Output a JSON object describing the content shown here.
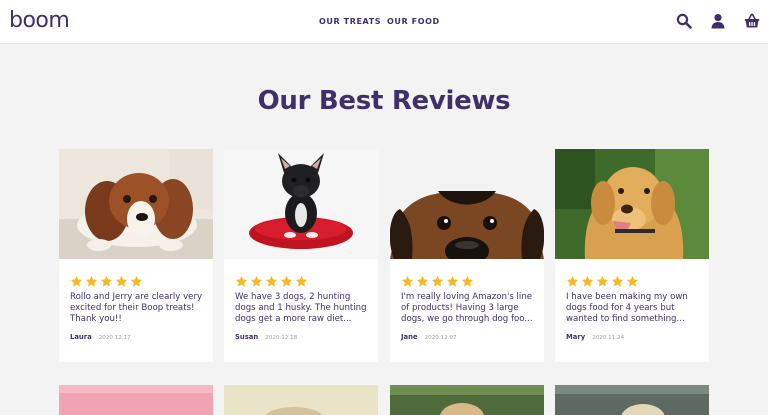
{
  "header": {
    "logo": "boom",
    "nav": [
      {
        "label": "OUR TREATS"
      },
      {
        "label": "OUR FOOD"
      }
    ],
    "icons": [
      "search-icon",
      "user-icon",
      "basket-icon"
    ]
  },
  "page_title": "Our Best Reviews",
  "colors": {
    "brand": "#3f2f6b",
    "star": "#f6b825",
    "background": "#f3f3f3"
  },
  "reviews": [
    {
      "rating": 5,
      "text": "Rollo and Jerry are clearly very excited for their Boop treats! Thank you!!",
      "author": "Laura",
      "date": "2020.12.17",
      "photo": "spaniel lying on rug"
    },
    {
      "rating": 5,
      "text": "We have 3 dogs, 2 hunting dogs and 1 husky. The hunting dogs get a more raw diet...",
      "author": "Susan",
      "date": "2020.12.18",
      "photo": "french bulldog on red cushion"
    },
    {
      "rating": 5,
      "text": "I'm really loving Amazon's line of products! Having 3 large dogs, we go through dog foo...",
      "author": "Jane",
      "date": "2020.12.07",
      "photo": "dog peeking over edge"
    },
    {
      "rating": 5,
      "text": "I have been making my own dogs food for 4 years but wanted to find something...",
      "author": "Mary",
      "date": "2020.11.24",
      "photo": "golden retriever outdoors"
    }
  ]
}
